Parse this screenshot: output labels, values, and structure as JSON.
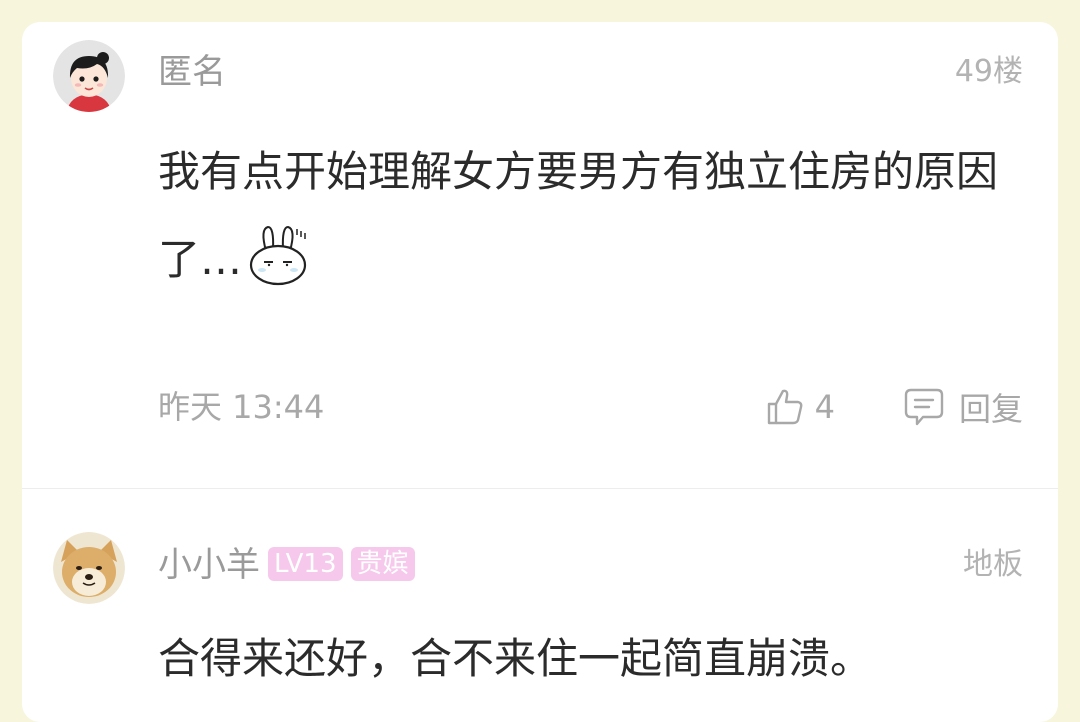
{
  "comments": [
    {
      "username": "匿名",
      "floor": "49楼",
      "text": "我有点开始理解女方要男方有独立住房的原因了…",
      "emoji_icon": "bunny-sweat-emoji-icon",
      "time": "昨天 13:44",
      "likes": "4",
      "reply_label": "回复",
      "avatar_icon": "cartoon-girl-avatar-icon"
    },
    {
      "username": "小小羊",
      "badges": [
        "LV13",
        "贵嫔"
      ],
      "floor": "地板",
      "text": "合得来还好，合不来住一起简直崩溃。",
      "avatar_icon": "shiba-dog-avatar-icon",
      "badge_color": "#f6c9ec"
    }
  ],
  "colors": {
    "page_background": "#f7f5dc",
    "card_background": "#ffffff",
    "meta_text": "#a8a8a8",
    "body_text": "#2b2b2b"
  }
}
